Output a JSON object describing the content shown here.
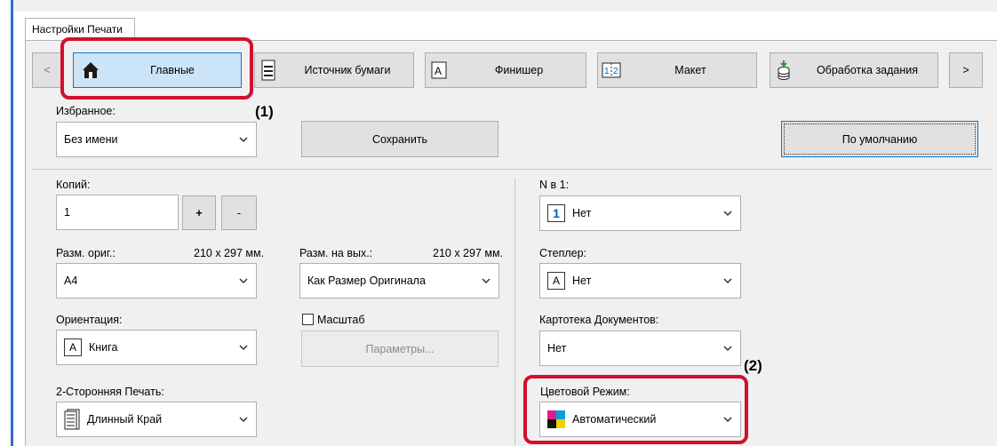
{
  "tab_header": "Настройки Печати",
  "nav": {
    "prev": "<",
    "next": ">",
    "tabs": [
      {
        "label": "Главные",
        "icon": "home-icon"
      },
      {
        "label": "Источник бумаги",
        "icon": "paper-tray-icon"
      },
      {
        "label": "Финишер",
        "icon": "finisher-icon"
      },
      {
        "label": "Макет",
        "icon": "layout-icon"
      },
      {
        "label": "Обработка задания",
        "icon": "job-handling-icon"
      }
    ]
  },
  "annotations": {
    "one": "(1)",
    "two": "(2)"
  },
  "favorites": {
    "label": "Избранное:",
    "value": "Без имени"
  },
  "buttons": {
    "save": "Сохранить",
    "defaults": "По умолчанию"
  },
  "copies": {
    "label": "Копий:",
    "value": "1",
    "plus": "+",
    "minus": "-"
  },
  "orig_size": {
    "label": "Разм. ориг.:",
    "dims": "210 x 297 мм.",
    "value": "A4"
  },
  "output_size": {
    "label": "Разм. на вых.:",
    "dims": "210 x 297 мм.",
    "value": "Как Размер Оригинала"
  },
  "orientation": {
    "label": "Ориентация:",
    "value": "Книга",
    "icon_letter": "A"
  },
  "zoom": {
    "label": "Масштаб",
    "params": "Параметры..."
  },
  "duplex": {
    "label": "2-Сторонняя Печать:",
    "value": "Длинный Край"
  },
  "nup": {
    "label": "N в 1:",
    "value": "Нет",
    "icon_digit": "1"
  },
  "stapler": {
    "label": "Степлер:",
    "value": "Нет",
    "icon_letter": "A"
  },
  "filing": {
    "label": "Картотека Документов:",
    "value": "Нет"
  },
  "color_mode": {
    "label": "Цветовой Режим:",
    "value": "Автоматический"
  },
  "colors": {
    "accent": "#0078d7",
    "highlight": "#d2102e",
    "active_tab": "#cce4f7"
  }
}
